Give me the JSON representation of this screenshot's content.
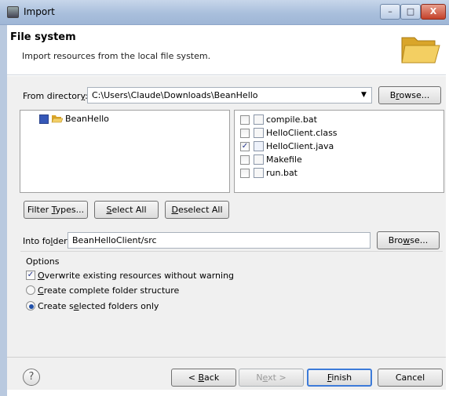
{
  "window": {
    "title": "Import",
    "controls": {
      "minimize": "–",
      "maximize": "□",
      "close": "X"
    }
  },
  "header": {
    "title": "File system",
    "description": "Import resources from the local file system.",
    "icon": "folder-icon"
  },
  "from_directory": {
    "label_pre": "From director",
    "label_key": "y",
    "label_post": ":",
    "value": "C:\\Users\\Claude\\Downloads\\BeanHello",
    "browse_pre": "B",
    "browse_key": "r",
    "browse_post": "owse..."
  },
  "folder_tree": {
    "items": [
      {
        "label": "BeanHello",
        "checked": true,
        "partial": true
      }
    ]
  },
  "files": [
    {
      "name": "compile.bat",
      "checked": false,
      "icon": "bat-file-icon"
    },
    {
      "name": "HelloClient.class",
      "checked": false,
      "icon": "class-file-icon"
    },
    {
      "name": "HelloClient.java",
      "checked": true,
      "icon": "java-file-icon"
    },
    {
      "name": "Makefile",
      "checked": false,
      "icon": "text-file-icon"
    },
    {
      "name": "run.bat",
      "checked": false,
      "icon": "bat-file-icon"
    }
  ],
  "filter_buttons": {
    "filter_pre": "Filter ",
    "filter_key": "T",
    "filter_post": "ypes...",
    "select_key": "S",
    "select_post": "elect All",
    "deselect_key": "D",
    "deselect_post": "eselect All"
  },
  "into_folder": {
    "label_pre": "Into fo",
    "label_key": "l",
    "label_post": "der:",
    "value": "BeanHelloClient/src",
    "browse_pre": "Bro",
    "browse_key": "w",
    "browse_post": "se..."
  },
  "options": {
    "title": "Options",
    "overwrite": {
      "key": "O",
      "rest": "verwrite existing resources without warning",
      "checked": true
    },
    "complete": {
      "key": "C",
      "rest": "reate complete folder structure",
      "selected": false
    },
    "selected_only": {
      "pre": "Create s",
      "key": "e",
      "rest": "lected folders only",
      "selected": true
    }
  },
  "footer": {
    "help": "?",
    "back_pre": "< ",
    "back_key": "B",
    "back_post": "ack",
    "next_pre": "N",
    "next_key": "e",
    "next_post": "xt >",
    "finish_key": "F",
    "finish_post": "inish",
    "cancel": "Cancel"
  },
  "colors": {
    "accent": "#3d7bd9",
    "check": "#24348c",
    "folder": "#e8b93b"
  }
}
